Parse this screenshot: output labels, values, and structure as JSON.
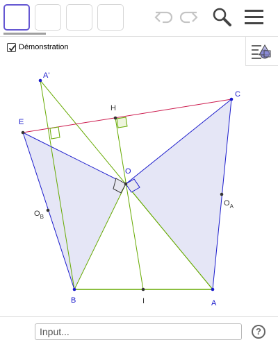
{
  "toolbar": {
    "tools": [
      "",
      "",
      "",
      ""
    ],
    "icons": [
      "undo-icon",
      "redo-icon",
      "search-icon",
      "menu-icon"
    ]
  },
  "demonstration": {
    "label": "Démonstration",
    "checked": true
  },
  "points": {
    "A_prime": "A'",
    "C": "C",
    "H": "H",
    "E": "E",
    "O": "O",
    "O_B_main": "O",
    "O_B_sub": "B",
    "O_A_main": "O",
    "O_A_sub": "A",
    "B": "B",
    "I": "I",
    "A": "A"
  },
  "colors": {
    "blue": "#1a1acc",
    "green": "#66aa00",
    "red": "#cc1a4d",
    "fill": "#e0e2f5"
  },
  "input": {
    "placeholder": "Input..."
  },
  "help": {
    "label": "?"
  }
}
